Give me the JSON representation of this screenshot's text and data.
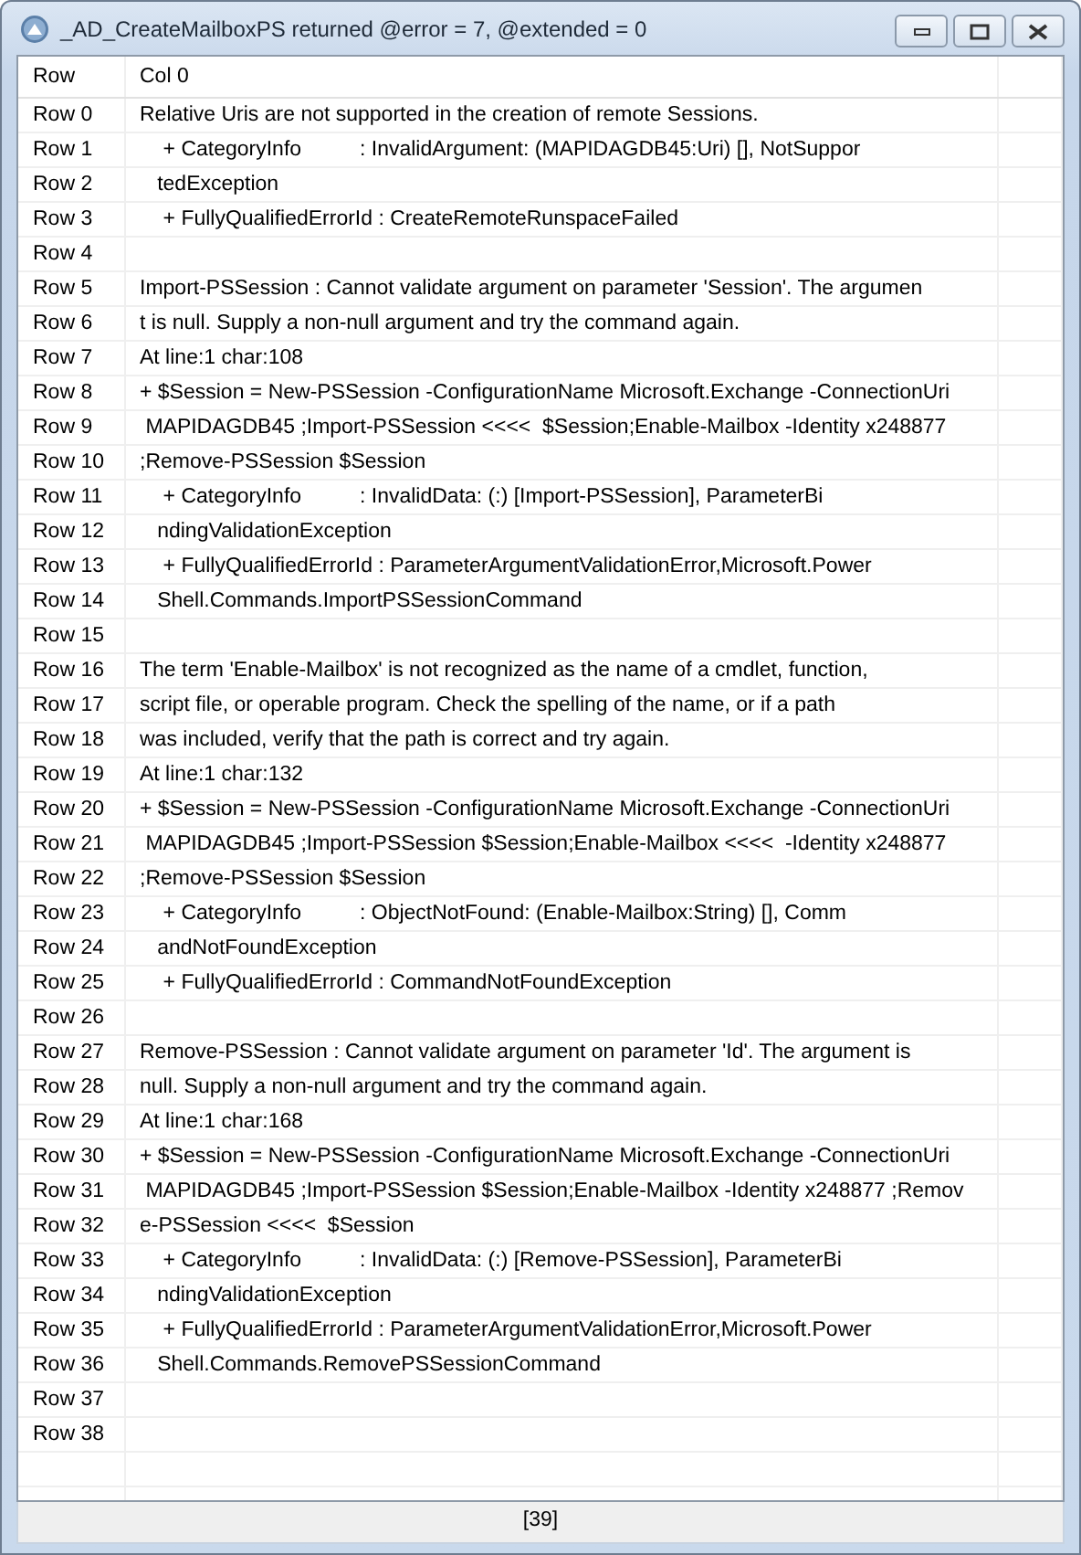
{
  "window": {
    "title": "_AD_CreateMailboxPS returned @error = 7, @extended = 0"
  },
  "table": {
    "columns": [
      "Row",
      "Col 0"
    ],
    "rows": [
      {
        "row": "Row 0",
        "col_0": "Relative Uris are not supported in the creation of remote Sessions."
      },
      {
        "row": "Row 1",
        "col_0": "    + CategoryInfo          : InvalidArgument: (MAPIDAGDB45:Uri) [], NotSuppor"
      },
      {
        "row": "Row 2",
        "col_0": "   tedException"
      },
      {
        "row": "Row 3",
        "col_0": "    + FullyQualifiedErrorId : CreateRemoteRunspaceFailed"
      },
      {
        "row": "Row 4",
        "col_0": ""
      },
      {
        "row": "Row 5",
        "col_0": "Import-PSSession : Cannot validate argument on parameter 'Session'. The argumen"
      },
      {
        "row": "Row 6",
        "col_0": "t is null. Supply a non-null argument and try the command again."
      },
      {
        "row": "Row 7",
        "col_0": "At line:1 char:108"
      },
      {
        "row": "Row 8",
        "col_0": "+ $Session = New-PSSession -ConfigurationName Microsoft.Exchange -ConnectionUri"
      },
      {
        "row": "Row 9",
        "col_0": " MAPIDAGDB45 ;Import-PSSession <<<<  $Session;Enable-Mailbox -Identity x248877"
      },
      {
        "row": "Row 10",
        "col_0": ";Remove-PSSession $Session"
      },
      {
        "row": "Row 11",
        "col_0": "    + CategoryInfo          : InvalidData: (:) [Import-PSSession], ParameterBi"
      },
      {
        "row": "Row 12",
        "col_0": "   ndingValidationException"
      },
      {
        "row": "Row 13",
        "col_0": "    + FullyQualifiedErrorId : ParameterArgumentValidationError,Microsoft.Power"
      },
      {
        "row": "Row 14",
        "col_0": "   Shell.Commands.ImportPSSessionCommand"
      },
      {
        "row": "Row 15",
        "col_0": ""
      },
      {
        "row": "Row 16",
        "col_0": "The term 'Enable-Mailbox' is not recognized as the name of a cmdlet, function,"
      },
      {
        "row": "Row 17",
        "col_0": "script file, or operable program. Check the spelling of the name, or if a path"
      },
      {
        "row": "Row 18",
        "col_0": "was included, verify that the path is correct and try again."
      },
      {
        "row": "Row 19",
        "col_0": "At line:1 char:132"
      },
      {
        "row": "Row 20",
        "col_0": "+ $Session = New-PSSession -ConfigurationName Microsoft.Exchange -ConnectionUri"
      },
      {
        "row": "Row 21",
        "col_0": " MAPIDAGDB45 ;Import-PSSession $Session;Enable-Mailbox <<<<  -Identity x248877"
      },
      {
        "row": "Row 22",
        "col_0": ";Remove-PSSession $Session"
      },
      {
        "row": "Row 23",
        "col_0": "    + CategoryInfo          : ObjectNotFound: (Enable-Mailbox:String) [], Comm"
      },
      {
        "row": "Row 24",
        "col_0": "   andNotFoundException"
      },
      {
        "row": "Row 25",
        "col_0": "    + FullyQualifiedErrorId : CommandNotFoundException"
      },
      {
        "row": "Row 26",
        "col_0": ""
      },
      {
        "row": "Row 27",
        "col_0": "Remove-PSSession : Cannot validate argument on parameter 'Id'. The argument is"
      },
      {
        "row": "Row 28",
        "col_0": "null. Supply a non-null argument and try the command again."
      },
      {
        "row": "Row 29",
        "col_0": "At line:1 char:168"
      },
      {
        "row": "Row 30",
        "col_0": "+ $Session = New-PSSession -ConfigurationName Microsoft.Exchange -ConnectionUri"
      },
      {
        "row": "Row 31",
        "col_0": " MAPIDAGDB45 ;Import-PSSession $Session;Enable-Mailbox -Identity x248877 ;Remov"
      },
      {
        "row": "Row 32",
        "col_0": "e-PSSession <<<<  $Session"
      },
      {
        "row": "Row 33",
        "col_0": "    + CategoryInfo          : InvalidData: (:) [Remove-PSSession], ParameterBi"
      },
      {
        "row": "Row 34",
        "col_0": "   ndingValidationException"
      },
      {
        "row": "Row 35",
        "col_0": "    + FullyQualifiedErrorId : ParameterArgumentValidationError,Microsoft.Power"
      },
      {
        "row": "Row 36",
        "col_0": "   Shell.Commands.RemovePSSessionCommand"
      },
      {
        "row": "Row 37",
        "col_0": ""
      },
      {
        "row": "Row 38",
        "col_0": ""
      }
    ]
  },
  "status_bar": "[39]"
}
